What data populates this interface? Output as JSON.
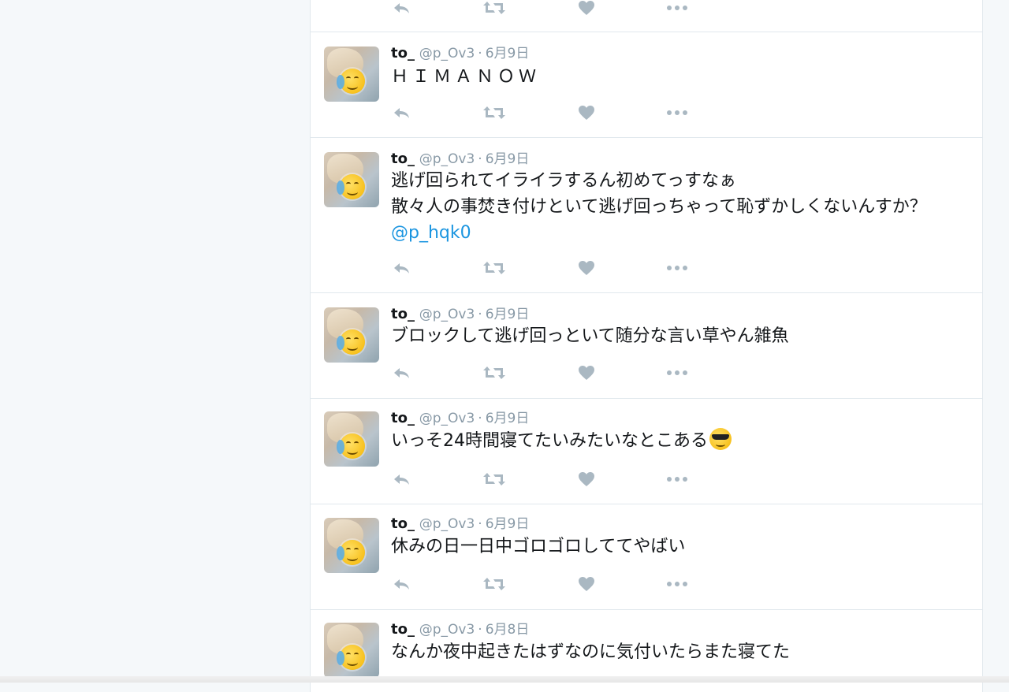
{
  "colors": {
    "background": "#f5f8fa",
    "card": "#ffffff",
    "border": "#e1e8ed",
    "name": "#14171a",
    "meta": "#8899a6",
    "mention": "#1b95e0",
    "icon": "#aab8c2"
  },
  "icons": {
    "reply": "reply-icon",
    "retweet": "retweet-icon",
    "like": "heart-icon",
    "more": "more-icon"
  },
  "tweets": [
    {
      "name": "to_",
      "handle": "@p_Ov3",
      "separator": "·",
      "date": "6月9日",
      "lines": [
        "ＨＩＭＡＮＯＷ"
      ]
    },
    {
      "name": "to_",
      "handle": "@p_Ov3",
      "separator": "·",
      "date": "6月9日",
      "lines": [
        "逃げ回られてイライラするん初めてっすなぁ",
        "散々人の事焚き付けといて逃げ回っちゃって恥ずかしくないんすか？"
      ],
      "mention": "@p_hqk0"
    },
    {
      "name": "to_",
      "handle": "@p_Ov3",
      "separator": "·",
      "date": "6月9日",
      "lines": [
        "ブロックして逃げ回っといて随分な言い草やん雑魚"
      ]
    },
    {
      "name": "to_",
      "handle": "@p_Ov3",
      "separator": "·",
      "date": "6月9日",
      "lines": [
        "いっそ24時間寝てたいみたいなとこある"
      ],
      "emoji": "smiling-face-with-sunglasses"
    },
    {
      "name": "to_",
      "handle": "@p_Ov3",
      "separator": "·",
      "date": "6月9日",
      "lines": [
        "休みの日一日中ゴロゴロしててやばい"
      ]
    },
    {
      "name": "to_",
      "handle": "@p_Ov3",
      "separator": "·",
      "date": "6月8日",
      "lines": [
        "なんか夜中起きたはずなのに気付いたらまた寝てた"
      ]
    }
  ]
}
